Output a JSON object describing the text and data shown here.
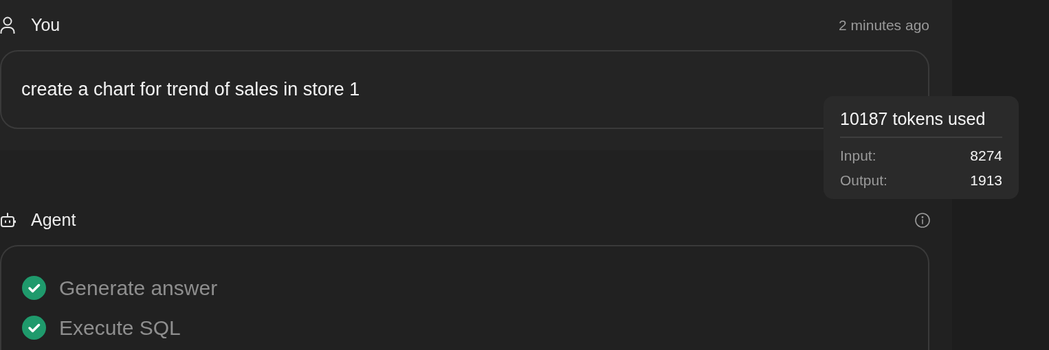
{
  "user_message": {
    "author": "You",
    "time": "2 minutes ago",
    "text": "create a chart for trend of sales in store 1"
  },
  "token_tooltip": {
    "title": "10187 tokens used",
    "rows": [
      {
        "label": "Input:",
        "value": "8274"
      },
      {
        "label": "Output:",
        "value": "1913"
      }
    ]
  },
  "agent_message": {
    "author": "Agent",
    "steps": [
      {
        "label": "Generate answer",
        "done": true
      },
      {
        "label": "Execute SQL",
        "done": true
      }
    ]
  }
}
